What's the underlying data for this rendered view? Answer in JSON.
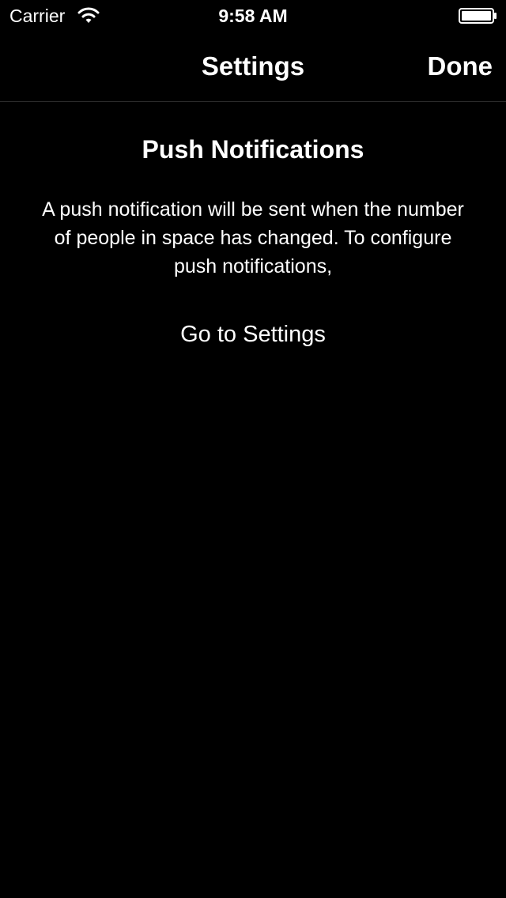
{
  "status_bar": {
    "carrier": "Carrier",
    "time": "9:58 AM",
    "wifi_icon": "wifi-icon",
    "battery_icon": "battery-icon"
  },
  "nav_bar": {
    "title": "Settings",
    "done_label": "Done"
  },
  "main": {
    "heading": "Push Notifications",
    "description": "A push notification will be sent when the number of people in space has changed. To configure push notifications,",
    "link_label": "Go to Settings"
  },
  "colors": {
    "background": "#000000",
    "text": "#ffffff",
    "separator": "#2b2b2b"
  }
}
